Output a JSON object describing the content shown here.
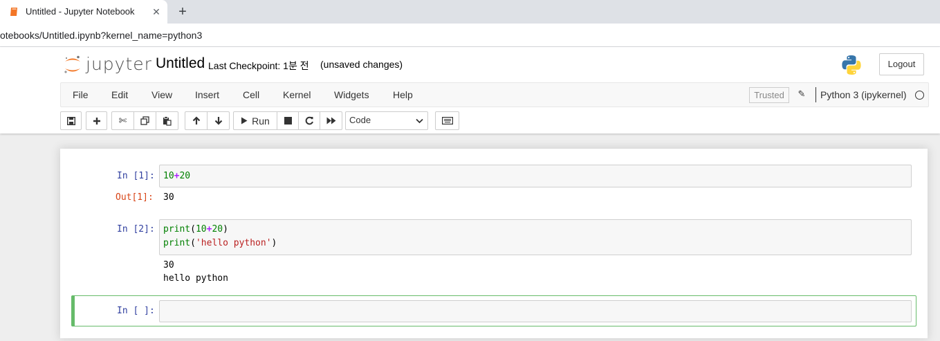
{
  "browser": {
    "tab_title": "Untitled - Jupyter Notebook",
    "url": "otebooks/Untitled.ipynb?kernel_name=python3"
  },
  "header": {
    "logo_text": "jupyter",
    "notebook_title": "Untitled",
    "checkpoint": "Last Checkpoint: 1분 전",
    "autosave": "(unsaved changes)",
    "logout_label": "Logout"
  },
  "menubar": {
    "items": [
      "File",
      "Edit",
      "View",
      "Insert",
      "Cell",
      "Kernel",
      "Widgets",
      "Help"
    ],
    "trusted": "Trusted",
    "kernel_name": "Python 3 (ipykernel)"
  },
  "toolbar": {
    "run_label": "Run",
    "cell_type": "Code"
  },
  "cells": [
    {
      "prompt": "In [1]:",
      "code": [
        "10+20"
      ],
      "output_prompt": "Out[1]:",
      "output": [
        "30"
      ]
    },
    {
      "prompt": "In [2]:",
      "code": [
        "print(10+20)",
        "print('hello python')"
      ],
      "output": [
        "30",
        "hello python"
      ]
    },
    {
      "prompt": "In [ ]:",
      "code": []
    }
  ],
  "colors": {
    "prompt_in": "#303f9f",
    "prompt_out": "#d84315",
    "selected_cell_border": "#66bb6a",
    "tab_favicon": "#f37626"
  }
}
